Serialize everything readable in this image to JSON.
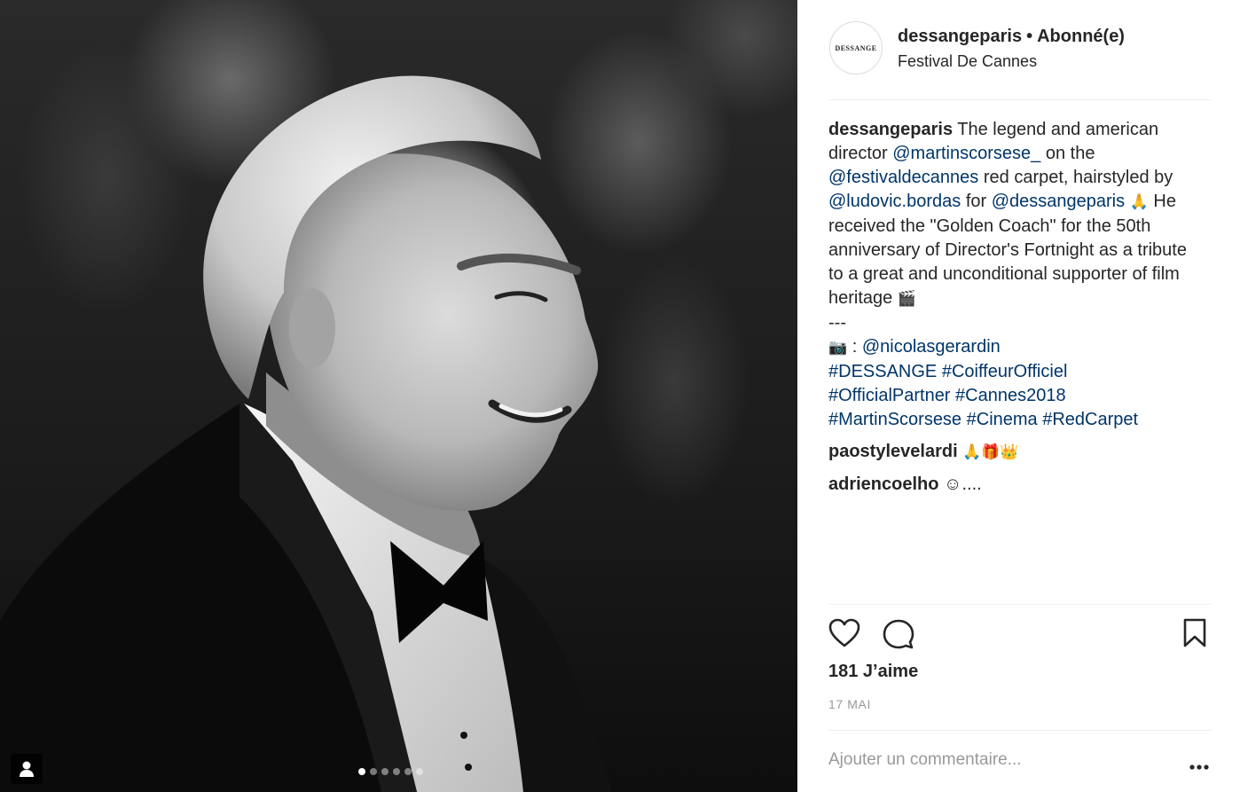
{
  "post": {
    "username": "dessangeparis",
    "separator": "•",
    "follow_status": "Abonné(e)",
    "location": "Festival De Cannes",
    "avatar_logo": "DESSANGE",
    "avatar_icon": "dessange-logo-icon"
  },
  "photo": {
    "description_icon": "photo-black-white-portrait",
    "carousel_dots": 6,
    "active_dot": 0,
    "user_tag_icon": "person-icon"
  },
  "caption": {
    "username": "dessangeparis",
    "line1_text": " The legend and american",
    "line2_text": "director ",
    "mention_scorsese": "@martinscorsese_",
    "line2_after": " on the",
    "mention_festival": "@festivaldecannes",
    "line3_after": " red carpet, hairstyled by",
    "mention_ludovic": "@ludovic.bordas",
    "line4_mid": " for ",
    "mention_dessange": "@dessangeparis",
    "praying_emoji": "🙏",
    "line4_after": " He",
    "line5": "received the \"Golden Coach\" for the 50th",
    "line6": "anniversary of Director's Fortnight as a tribute",
    "line7": "to a great and unconditional supporter of film",
    "line8": "heritage ",
    "clapper_emoji": "🎬",
    "separator_line": "---",
    "camera_emoji": "📷",
    "credit_prefix": " : ",
    "mention_photographer": "@nicolasgerardin",
    "hashtags_line1": [
      "#DESSANGE",
      "#CoiffeurOfficiel"
    ],
    "hashtags_line2": [
      "#OfficialPartner",
      "#Cannes2018"
    ],
    "hashtags_line3": [
      "#MartinScorsese",
      "#Cinema",
      "#RedCarpet"
    ]
  },
  "comments": [
    {
      "username": "paostylevelardi",
      "text": " 🙏🎁👑"
    },
    {
      "username": "adriencoelho",
      "text": " ☺...."
    }
  ],
  "actions": {
    "like_icon": "heart-icon",
    "comment_icon": "comment-bubble-icon",
    "save_icon": "bookmark-icon"
  },
  "likes_text": "181 J’aime",
  "date_text": "17 MAI",
  "add_comment": {
    "placeholder": "Ajouter un commentaire...",
    "value": ""
  },
  "more_icon": "more-options-icon",
  "colors": {
    "link": "#003569",
    "text": "#262626",
    "muted": "#999999",
    "divider": "#efefef"
  }
}
